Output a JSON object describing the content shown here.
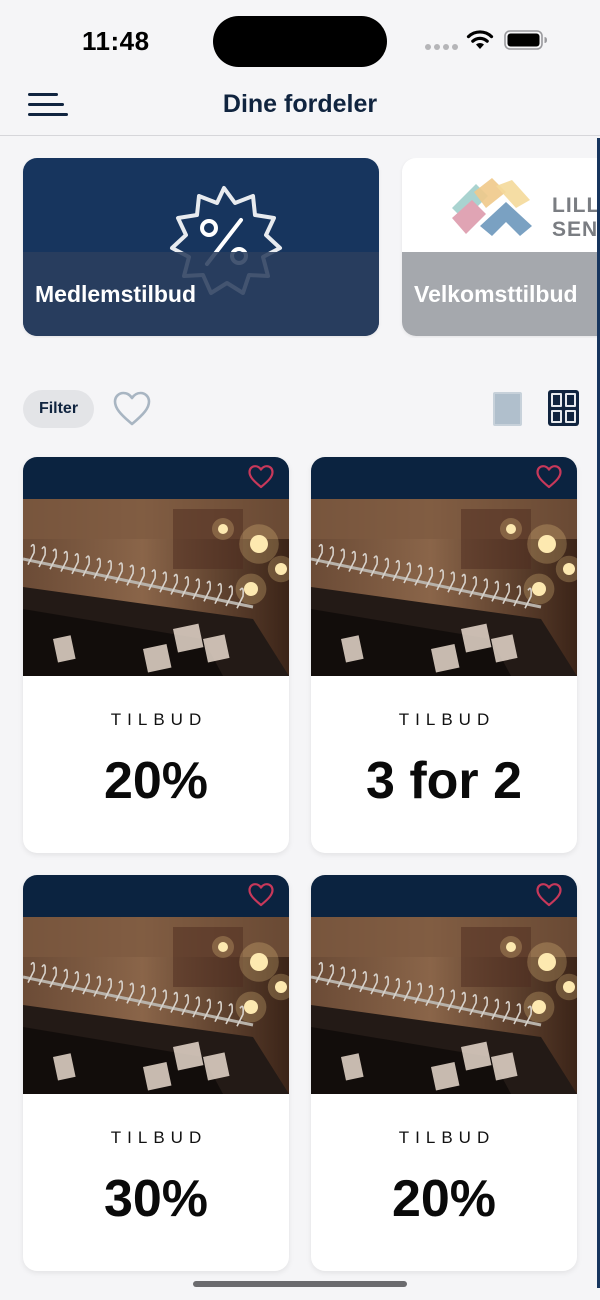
{
  "status_bar": {
    "time": "11:48"
  },
  "nav": {
    "title": "Dine fordeler",
    "menu_icon": "hamburger-menu-icon"
  },
  "categories": [
    {
      "label": "Medlemstilbud",
      "icon": "percent-badge-icon"
    },
    {
      "label": "Velkomsttilbud",
      "logo_text": "LILL\nSENT"
    }
  ],
  "filter": {
    "label": "Filter",
    "favorites_icon": "heart-outline-icon"
  },
  "view_toggle": {
    "single_icon": "single-view-icon",
    "grid_icon": "grid-view-icon",
    "selected": "grid"
  },
  "offers": [
    {
      "kicker": "TILBUD",
      "value": "20%"
    },
    {
      "kicker": "TILBUD",
      "value": "3 for 2"
    },
    {
      "kicker": "TILBUD",
      "value": "30%"
    },
    {
      "kicker": "TILBUD",
      "value": "20%"
    }
  ],
  "colors": {
    "navy": "#10243f",
    "card_header": "#0b2340",
    "heart_accent": "#c8385a",
    "member_card": "#17355e",
    "welcome_overlay": "#a5a8ad"
  }
}
